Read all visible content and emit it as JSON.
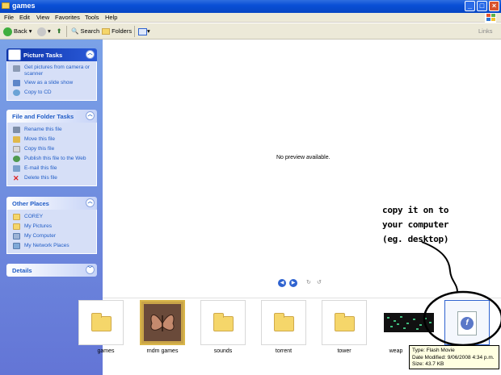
{
  "window": {
    "title": "games"
  },
  "menu": [
    "File",
    "Edit",
    "View",
    "Favorites",
    "Tools",
    "Help"
  ],
  "toolbar": {
    "back": "Back",
    "search": "Search",
    "folders": "Folders",
    "links": "Links"
  },
  "sidebar": {
    "picture_tasks": {
      "title": "Picture Tasks",
      "items": [
        "Get pictures from camera or scanner",
        "View as a slide show",
        "Copy to CD"
      ]
    },
    "file_folder_tasks": {
      "title": "File and Folder Tasks",
      "items": [
        "Rename this file",
        "Move this file",
        "Copy this file",
        "Publish this file to the Web",
        "E-mail this file",
        "Delete this file"
      ]
    },
    "other_places": {
      "title": "Other Places",
      "items": [
        "COREY",
        "My Pictures",
        "My Computer",
        "My Network Places"
      ]
    },
    "details": {
      "title": "Details"
    }
  },
  "preview": {
    "message": "No preview available."
  },
  "filmstrip": {
    "items": [
      {
        "label": "games",
        "type": "folder"
      },
      {
        "label": "rndm games",
        "type": "folder-image"
      },
      {
        "label": "sounds",
        "type": "folder"
      },
      {
        "label": "torrent",
        "type": "folder"
      },
      {
        "label": "tower",
        "type": "folder"
      },
      {
        "label": "weap",
        "type": "image"
      },
      {
        "label": "",
        "type": "flash"
      }
    ]
  },
  "tooltip": {
    "type": "Type: Flash Movie",
    "date": "Date Modified: 9/06/2008 4:34 p.m.",
    "size": "Size: 43.7 KB"
  },
  "annotation": {
    "lines": [
      "copy it on to",
      "your computer",
      "(eg. desktop)"
    ]
  },
  "colors": {
    "titlebar": "#0a4fd6",
    "sidebar": "#6f8fe0",
    "link": "#215dc6",
    "tooltip_bg": "#ffffe1"
  }
}
